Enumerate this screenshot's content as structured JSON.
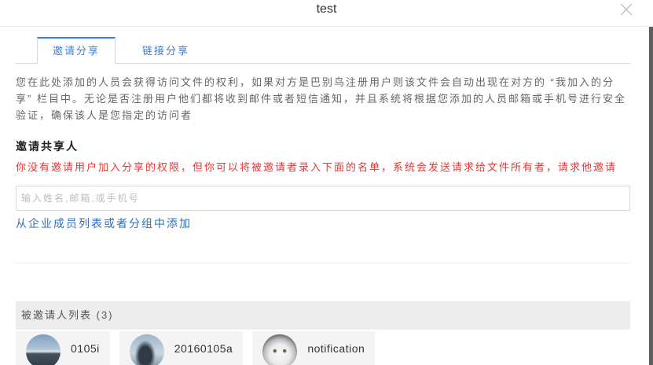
{
  "dialog": {
    "title": "test",
    "close_icon": "close-icon"
  },
  "tabs": [
    {
      "label": "邀请分享",
      "active": true
    },
    {
      "label": "链接分享",
      "active": false
    }
  ],
  "description": "您在此处添加的人员会获得访问文件的权利，如果对方是巴别鸟注册用户则该文件会自动出现在对方的 “我加入的分享” 栏目中。无论是否注册用户他们都将收到邮件或者短信通知，并且系统将根据您添加的人员邮箱或手机号进行安全验证，确保该人是您指定的访问者",
  "invite_section": {
    "heading": "邀请共享人",
    "permission_warning": "你没有邀请用户加入分享的权限，但你可以将被邀请者录入下面的名单，系统会发送请求给文件所有者，请求他邀请",
    "input_value": "",
    "input_placeholder": "输入姓名,邮箱,或手机号",
    "add_from_org_link": "从企业成员列表或者分组中添加"
  },
  "invitee_list": {
    "header": "被邀请人列表 (3)",
    "items": [
      {
        "name": "0105i",
        "avatar": "landscape-photo-avatar"
      },
      {
        "name": "20160105a",
        "avatar": "person-photo-avatar"
      },
      {
        "name": "notification",
        "avatar": "cat-photo-avatar"
      }
    ]
  },
  "colors": {
    "accent": "#3b82d6",
    "link": "#2f6fb8",
    "warning": "#e53935",
    "list_header_bg": "#ededed"
  }
}
